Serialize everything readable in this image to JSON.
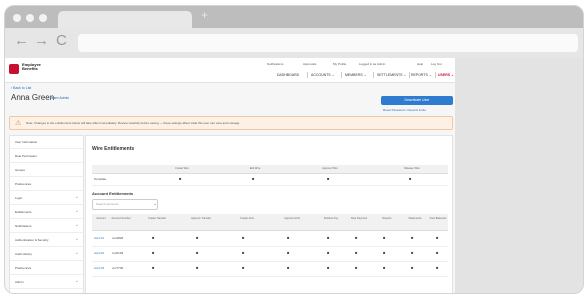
{
  "browser": {
    "new_tab_glyph": "+",
    "nav": {
      "back": "←",
      "forward": "→",
      "reload": "C"
    }
  },
  "app": {
    "brand": [
      "Employee",
      "Benefits"
    ],
    "util_links": [
      "Notifications",
      "Approvals",
      "My Profile",
      "Logged in as Admin",
      "Help",
      "Log Out"
    ],
    "menu": [
      {
        "label": "DASHBOARD",
        "active": false
      },
      {
        "label": "ACCOUNTS ⌄",
        "active": false
      },
      {
        "label": "MEMBERS ⌄",
        "active": false
      },
      {
        "label": "SETTLEMENTS ⌄",
        "active": false
      },
      {
        "label": "REPORTS ⌄",
        "active": false
      },
      {
        "label": "USERS ⌄",
        "active": true
      }
    ],
    "breadcrumb": "‹ Back to List",
    "page_title": "Anna Green",
    "page_subtitle": "Team Admin",
    "primary_button": "Deactivate User",
    "small_link": "Reset Password • Resend Invite",
    "alert": {
      "icon": "⚠",
      "text": "Note: Changes to the entitlements below will take effect immediately. Review carefully before saving — these settings affect what this user can view and manage."
    },
    "sidebar": [
      {
        "label": "User Information",
        "chevron": false
      },
      {
        "label": "Role Permission",
        "chevron": false
      },
      {
        "label": "Groups",
        "chevron": false
      },
      {
        "label": "Preferences",
        "chevron": false
      },
      {
        "label": "Login",
        "chevron": true
      },
      {
        "label": "Entitlements",
        "chevron": true
      },
      {
        "label": "Notifications",
        "chevron": true
      },
      {
        "label": "Authentication & Security",
        "chevron": true
      },
      {
        "label": "Audit History",
        "chevron": true
      },
      {
        "label": "Preferences",
        "chevron": false
      },
      {
        "label": "Admin",
        "chevron": true
      }
    ],
    "wire": {
      "title": "Wire Entitlements",
      "columns": [
        "Create Wire",
        "Edit Wire",
        "Approve Wire",
        "Release Wire"
      ],
      "rows": [
        {
          "label": "Template",
          "checks": [
            "■",
            "■",
            "■",
            "■"
          ]
        }
      ]
    },
    "account": {
      "title": "Account Entitlements",
      "search_placeholder": "Search accounts",
      "columns": [
        "Account",
        "Account Number",
        "Create Transfer",
        "Approve Transfer",
        "Create ACH",
        "Approve ACH",
        "Positive Pay",
        "Stop Payment",
        "Reports",
        "Statements",
        "View Balances",
        "Export Data"
      ],
      "rows": [
        {
          "label": "Acct 01",
          "number": "xxx4826",
          "checks": [
            "■",
            "■",
            "■",
            "■",
            "■",
            "■",
            "■",
            "■",
            "■",
            "■"
          ]
        },
        {
          "label": "Acct 02",
          "number": "xxx5193",
          "checks": [
            "■",
            "■",
            "■",
            "■",
            "■",
            "■",
            "■",
            "■",
            "■",
            "■"
          ]
        },
        {
          "label": "Acct 03",
          "number": "xxx7740",
          "checks": [
            "■",
            "■",
            "■",
            "■",
            "■",
            "■",
            "■",
            "■",
            "■",
            "■"
          ]
        }
      ]
    }
  }
}
